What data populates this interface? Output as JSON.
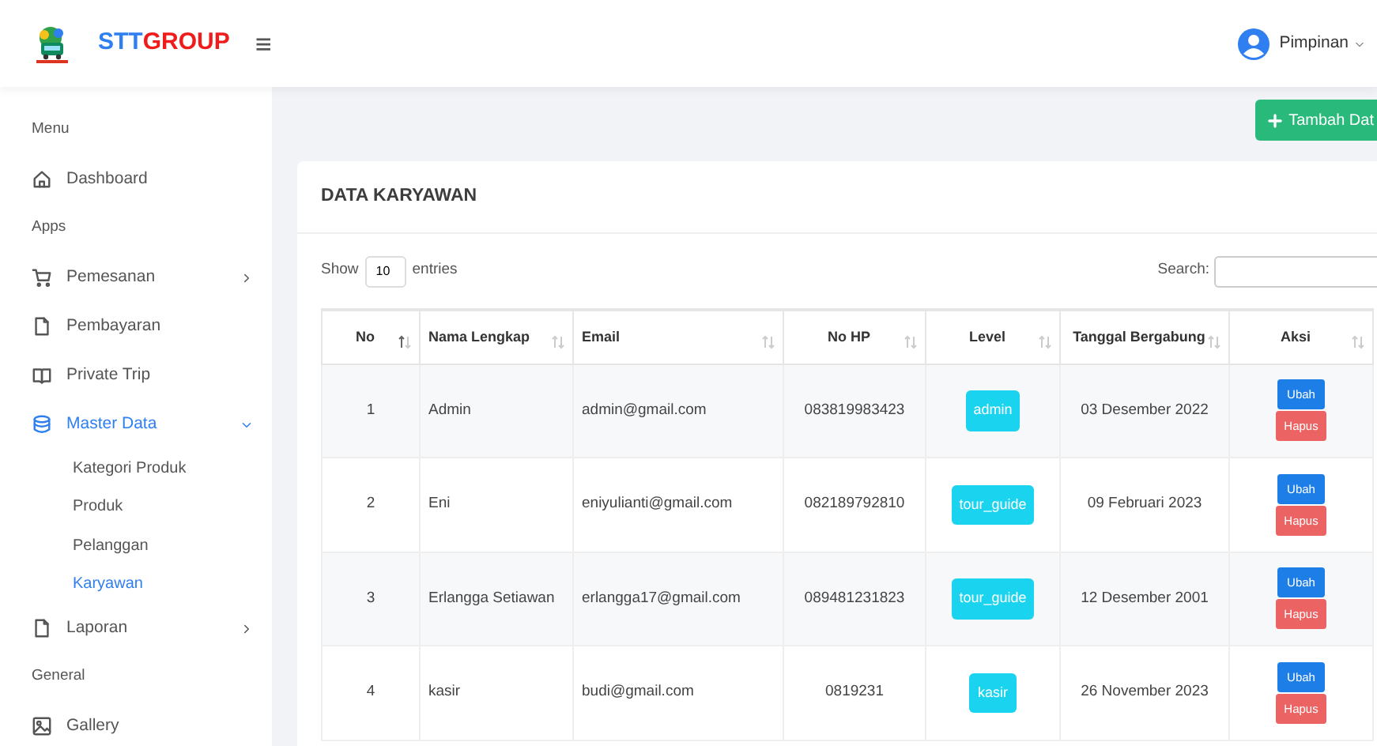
{
  "brand": {
    "part_1": "STT",
    "part_2": "GROUP",
    "menu_toggle": "≡"
  },
  "user": {
    "name": "Pimpinan"
  },
  "sidebar": [
    {
      "header": "Menu",
      "items": [
        {
          "label": "Dashboard",
          "selected": false
        }
      ]
    },
    {
      "header": "Apps",
      "items": [
        {
          "label": "Pemesanan",
          "selected": false,
          "expanded": false
        },
        {
          "label": "Pembayaran",
          "selected": false
        },
        {
          "label": "Private Trip",
          "selected": false
        },
        {
          "label": "Master Data",
          "selected": true,
          "expanded": true,
          "children": [
            {
              "label": "Kategori Produk",
              "selected": false
            },
            {
              "label": "Produk",
              "selected": false
            },
            {
              "label": "Pelanggan",
              "selected": false
            },
            {
              "label": "Karyawan",
              "selected": true
            }
          ]
        },
        {
          "label": "Laporan",
          "selected": false,
          "expanded": false
        }
      ]
    },
    {
      "header": "General",
      "items": [
        {
          "label": "Gallery",
          "selected": false
        }
      ]
    }
  ],
  "add_button": {
    "label": "Tambah Dat"
  },
  "card": {
    "title": "DATA KARYAWAN",
    "length": {
      "before": "Show",
      "value": "10",
      "after": "entries"
    },
    "search": {
      "label": "Search:"
    },
    "table": {
      "columns": [
        {
          "label": "No",
          "sorted": true
        },
        {
          "label": "Nama Lengkap",
          "sorted": false
        },
        {
          "label": "Email",
          "sorted": false
        },
        {
          "label": "No HP",
          "sorted": false
        },
        {
          "label": "Level",
          "sorted": false
        },
        {
          "label": "Tanggal Bergabung",
          "sorted": false
        },
        {
          "label": "Aksi",
          "sorted": false
        }
      ],
      "rows": [
        {
          "no": "1",
          "name": "Admin",
          "email": "admin@gmail.com",
          "phone": "083819983423",
          "level": "admin",
          "joined": "03 Desember 2022",
          "edit": "Ubah",
          "delete": "Hapus"
        },
        {
          "no": "2",
          "name": "Eni",
          "email": "eniyulianti@gmail.com",
          "phone": "082189792810",
          "level": "tour_guide",
          "joined": "09 Februari 2023",
          "edit": "Ubah",
          "delete": "Hapus"
        },
        {
          "no": "3",
          "name": "Erlangga Setiawan",
          "email": "erlangga17@gmail.com",
          "phone": "089481231823",
          "level": "tour_guide",
          "joined": "12 Desember 2001",
          "edit": "Ubah",
          "delete": "Hapus"
        },
        {
          "no": "4",
          "name": "kasir",
          "email": "budi@gmail.com",
          "phone": "0819231",
          "level": "kasir",
          "joined": "26 November 2023",
          "edit": "Ubah",
          "delete": "Hapus"
        }
      ]
    }
  }
}
